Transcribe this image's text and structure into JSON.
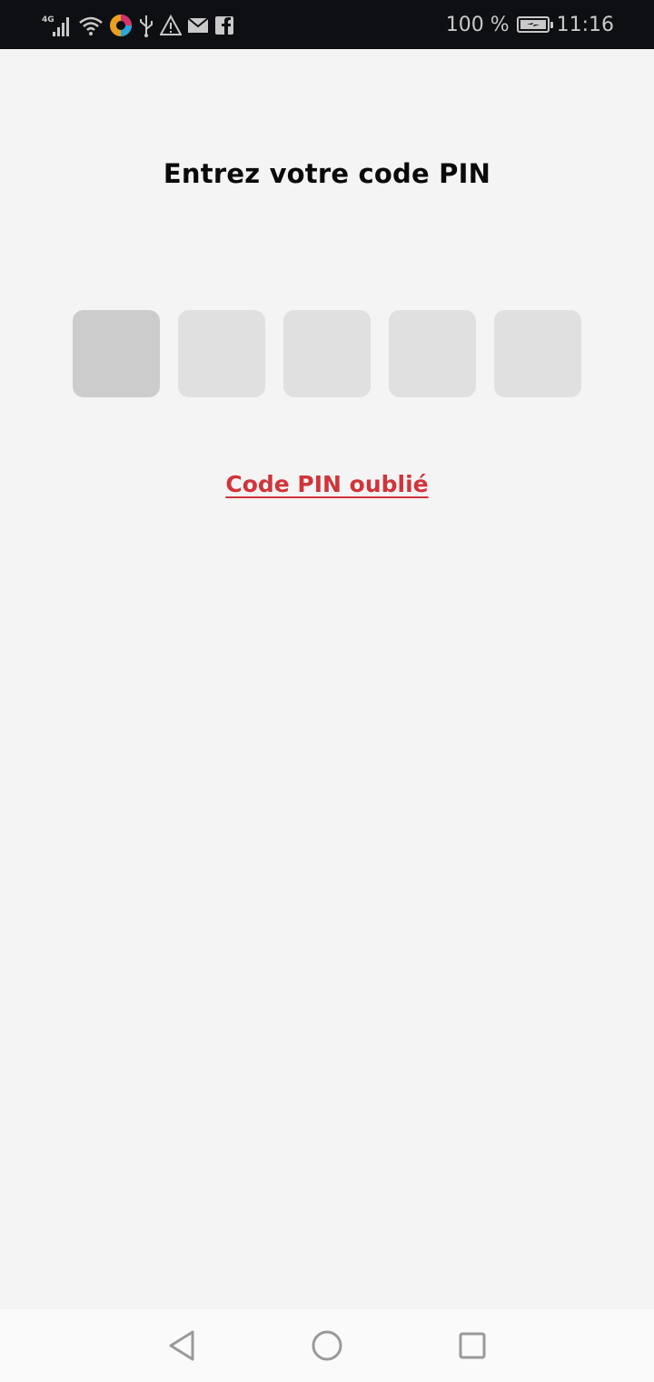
{
  "status_bar": {
    "network_label": "4G",
    "battery_percent": "100 %",
    "time": "11:16",
    "icons": [
      "signal-icon",
      "wifi-icon",
      "app-notification-icon",
      "usb-icon",
      "warning-icon",
      "mail-icon",
      "facebook-icon",
      "battery-icon"
    ]
  },
  "pin_screen": {
    "title": "Entrez votre code PIN",
    "pin_length": 5,
    "active_index": 0,
    "forgot_label": "Code PIN oublié"
  },
  "colors": {
    "background": "#f4f4f4",
    "status_bar": "#0e0f13",
    "pin_box": "#e0e0e0",
    "pin_box_active": "#cccccc",
    "accent": "#d0343a"
  },
  "nav_bar": {
    "icons": [
      "back-icon",
      "home-icon",
      "recents-icon"
    ]
  }
}
